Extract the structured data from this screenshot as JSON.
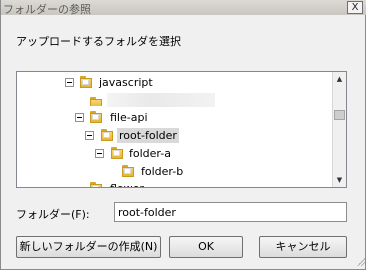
{
  "dialog": {
    "title": "フォルダーの参照",
    "close_glyph": "X",
    "instruction": "アップロードするフォルダを選択"
  },
  "tree": {
    "items": [
      {
        "label": "javascript"
      },
      {
        "label": "file-api"
      },
      {
        "label": "root-folder"
      },
      {
        "label": "folder-a"
      },
      {
        "label": "folder-b"
      },
      {
        "label": "flower"
      }
    ],
    "selected": "root-folder"
  },
  "scrollbar": {
    "up_glyph": "▲",
    "down_glyph": "▼"
  },
  "folder_field": {
    "label": "フォルダー(F):",
    "value": "root-folder"
  },
  "buttons": {
    "new_folder": "新しいフォルダーの作成(N)",
    "ok": "OK",
    "cancel": "キャンセル"
  }
}
